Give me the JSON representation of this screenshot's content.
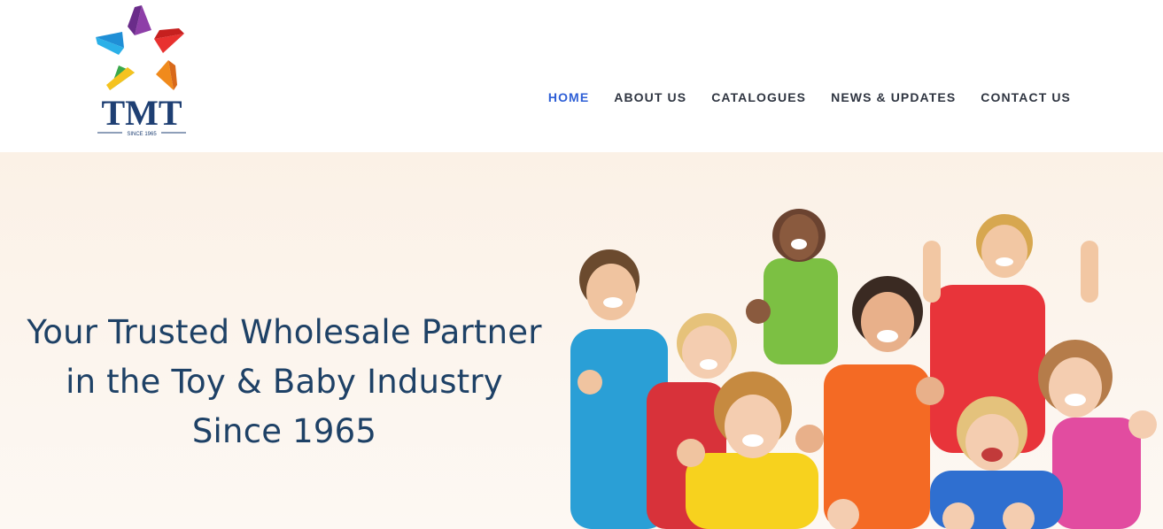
{
  "brand": {
    "logo_text": "TMT",
    "logo_tagline": "SINCE 1965",
    "logo_icon": "star-logo-icon"
  },
  "nav": {
    "items": [
      {
        "label": "HOME",
        "active": true
      },
      {
        "label": "ABOUT US",
        "active": false
      },
      {
        "label": "CATALOGUES",
        "active": false
      },
      {
        "label": "NEWS & UPDATES",
        "active": false
      },
      {
        "label": "CONTACT US",
        "active": false
      }
    ],
    "active_color": "#2e5fd6",
    "text_color": "#2f3541"
  },
  "hero": {
    "lines": [
      "Your Trusted Wholesale Partner",
      "in the Toy & Baby Industry",
      "Since 1965"
    ],
    "text_color": "#1e4166",
    "background": "#fbf1e6",
    "image": "group-of-kids-thumbs-up-image"
  }
}
